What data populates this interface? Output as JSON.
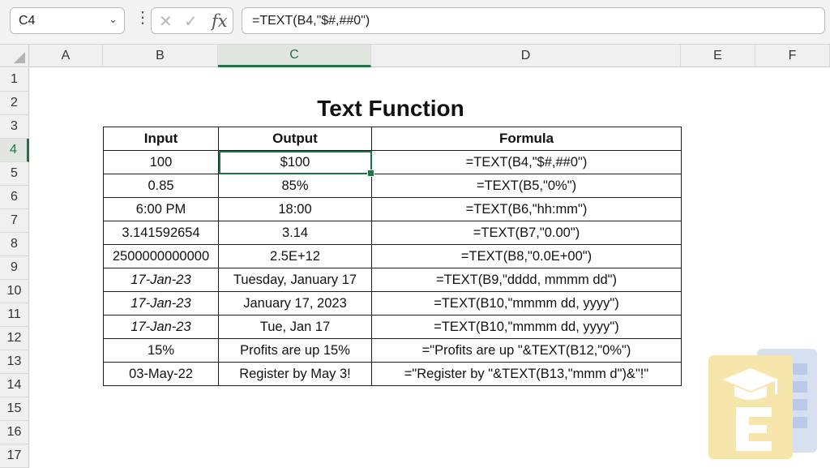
{
  "formula_bar": {
    "name_box": "C4",
    "formula": "=TEXT(B4,\"$#,##0\")",
    "cancel_icon": "x-icon",
    "enter_icon": "check-icon",
    "fx_label": "fx"
  },
  "columns": [
    "A",
    "B",
    "C",
    "D",
    "E",
    "F"
  ],
  "selected_column": "C",
  "rows": [
    "1",
    "2",
    "3",
    "4",
    "5",
    "6",
    "7",
    "8",
    "9",
    "10",
    "11",
    "12",
    "13",
    "14",
    "15",
    "16",
    "17"
  ],
  "selected_row": "4",
  "sheet": {
    "title": "Text Function",
    "headers": [
      "Input",
      "Output",
      "Formula"
    ],
    "data": [
      {
        "input": "100",
        "output": "$100",
        "formula": "=TEXT(B4,\"$#,##0\")"
      },
      {
        "input": "0.85",
        "output": "85%",
        "formula": "=TEXT(B5,\"0%\")"
      },
      {
        "input": "6:00 PM",
        "output": "18:00",
        "formula": "=TEXT(B6,\"hh:mm\")"
      },
      {
        "input": "3.141592654",
        "output": "3.14",
        "formula": "=TEXT(B7,\"0.00\")"
      },
      {
        "input": "2500000000000",
        "output": "2.5E+12",
        "formula": "=TEXT(B8,\"0.0E+00\")"
      },
      {
        "input": "17-Jan-23",
        "output": "Tuesday, January 17",
        "formula": "=TEXT(B9,\"dddd, mmmm dd\")"
      },
      {
        "input": "17-Jan-23",
        "output": "January 17, 2023",
        "formula": "=TEXT(B10,\"mmmm dd, yyyy\")"
      },
      {
        "input": "17-Jan-23",
        "output": "Tue, Jan 17",
        "formula": "=TEXT(B10,\"mmmm dd, yyyy\")"
      },
      {
        "input": "15%",
        "output": "Profits are up 15%",
        "formula": "=\"Profits are up \"&TEXT(B12,\"0%\")"
      },
      {
        "input": "03-May-22",
        "output": "Register by May 3!",
        "formula": "=\"Register by \"&TEXT(B13,\"mmm d\")&\"!\""
      }
    ]
  },
  "colors": {
    "accent": "#217346",
    "logo_yellow": "#f6e3a6",
    "logo_blue": "#c9d6ec"
  }
}
